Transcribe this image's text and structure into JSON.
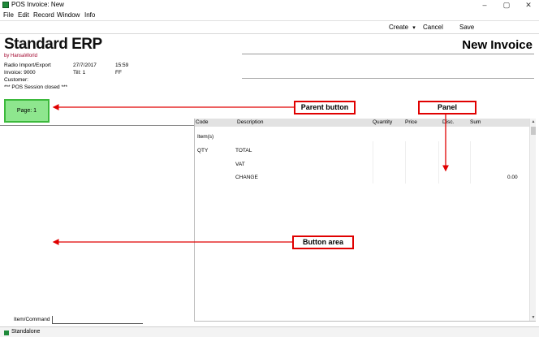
{
  "window": {
    "title": "POS Invoice: New"
  },
  "window_controls": {
    "minimize": "–",
    "maximize": "▢",
    "close": "✕"
  },
  "menu": [
    "File",
    "Edit",
    "Record",
    "Window",
    "Info"
  ],
  "toolbar": {
    "create_label": "Create",
    "create_arrow": "▾",
    "cancel_label": "Cancel",
    "save_label": "Save"
  },
  "logo": {
    "name": "Standard ERP",
    "sub": "by HansaWorld"
  },
  "document": {
    "title": "New Invoice"
  },
  "info": {
    "company": "Radio Import/Export",
    "date": "27/7/2017",
    "time": "15:59",
    "invoice": "Invoice: 9000",
    "till": "Till: 1",
    "code": "FF",
    "customer": "Customer:",
    "session": "*** POS Session closed ***"
  },
  "page_button": {
    "label": "Page: 1"
  },
  "grid": {
    "headers": {
      "code": "Code",
      "description": "Description",
      "quantity": "Quantity",
      "price": "Price",
      "disc": "Disc.",
      "sum": "Sum"
    },
    "items_label": "Item(s)",
    "qty_label": "QTY",
    "total_label": "TOTAL",
    "vat_label": "VAT",
    "change_label": "CHANGE",
    "change_value": "0.00"
  },
  "command": {
    "label": "Item/Command",
    "value": ""
  },
  "status": {
    "text": "Standalone"
  },
  "annotations": {
    "parent_button": "Parent button",
    "panel": "Panel",
    "button_area": "Button area"
  },
  "colors": {
    "accent_green": "#8ee68e",
    "callout_red": "#e00000",
    "brand_red": "#a0002a"
  }
}
